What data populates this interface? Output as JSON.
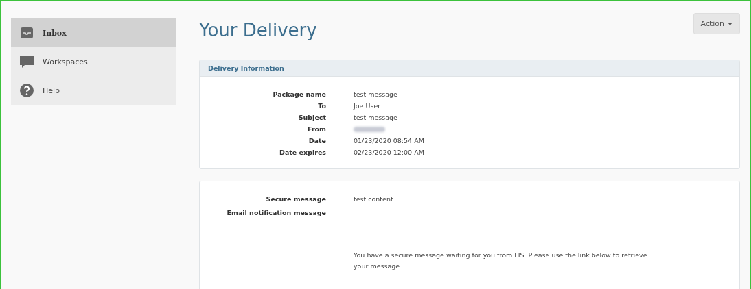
{
  "sidebar": {
    "items": [
      {
        "label": "Inbox",
        "selected": true
      },
      {
        "label": "Workspaces",
        "selected": false
      },
      {
        "label": "Help",
        "selected": false
      }
    ]
  },
  "page": {
    "title": "Your Delivery",
    "action_button": "Action"
  },
  "delivery_information": {
    "title": "Delivery Information",
    "fields": [
      {
        "label": "Package name",
        "value": "test message"
      },
      {
        "label": "To",
        "value": "Joe User"
      },
      {
        "label": "Subject",
        "value": "test message"
      },
      {
        "label": "From",
        "kind": "blurred"
      },
      {
        "label": "Date",
        "value": "01/23/2020 08:54 AM"
      },
      {
        "label": "Date expires",
        "value": "02/23/2020 12:00 AM"
      }
    ]
  },
  "message": {
    "fields": [
      {
        "label": "Secure message",
        "value": "test content"
      },
      {
        "label": "Email notification message"
      }
    ],
    "notification_text": "You have a secure message waiting for you from FIS. Please use the link below to retrieve your message."
  }
}
